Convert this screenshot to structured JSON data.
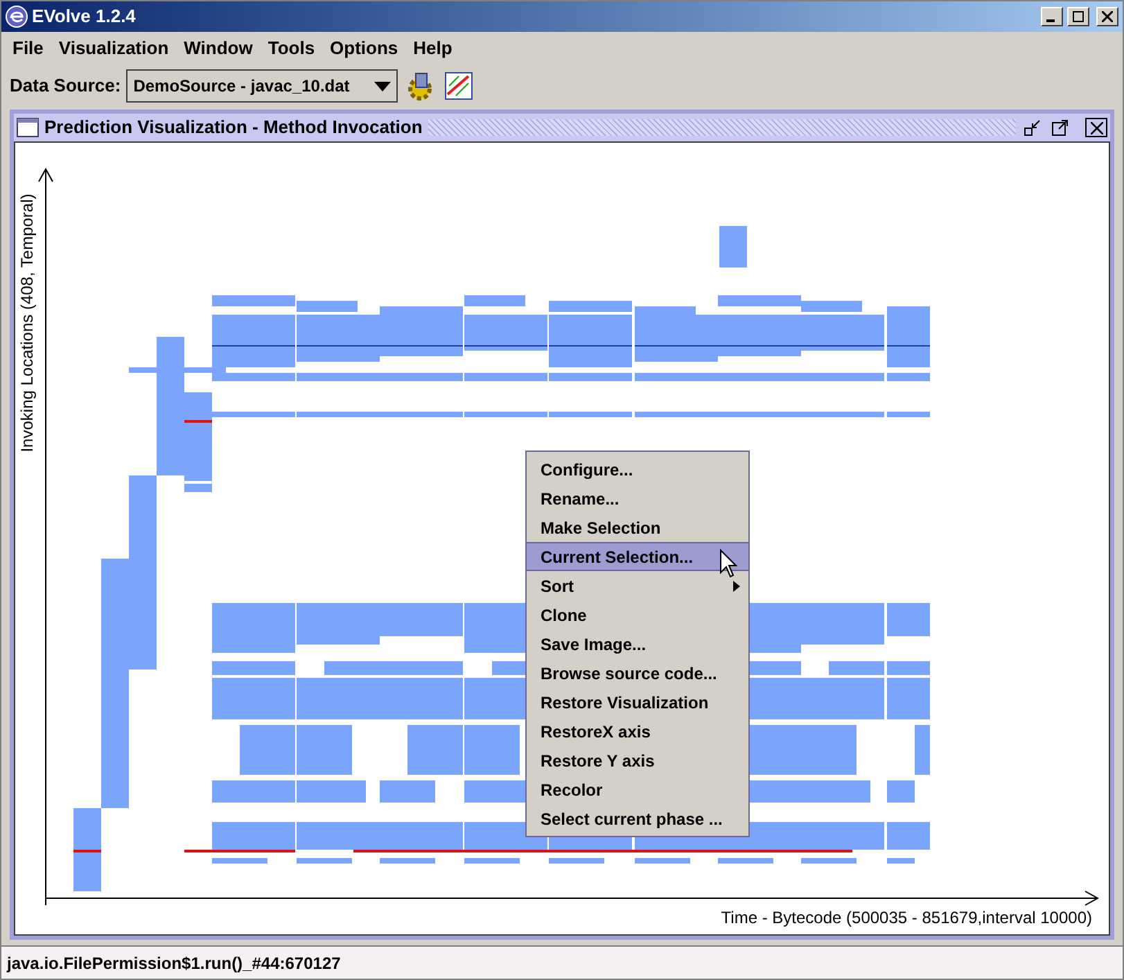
{
  "window": {
    "title": "EVolve 1.2.4"
  },
  "menu": [
    {
      "label": "File"
    },
    {
      "label": "Visualization"
    },
    {
      "label": "Window"
    },
    {
      "label": "Tools"
    },
    {
      "label": "Options"
    },
    {
      "label": "Help"
    }
  ],
  "toolbar": {
    "label": "Data Source:",
    "data_source": "DemoSource - javac_10.dat"
  },
  "frame": {
    "title": "Prediction Visualization - Method Invocation",
    "y_axis_label": "Invoking Locations (408, Temporal)",
    "x_axis_label": "Time - Bytecode (500035 - 851679,interval 10000)"
  },
  "context_menu": [
    {
      "label": "Configure...",
      "selected": false,
      "submenu": false
    },
    {
      "label": "Rename...",
      "selected": false,
      "submenu": false
    },
    {
      "label": "Make Selection",
      "selected": false,
      "submenu": false
    },
    {
      "label": "Current Selection...",
      "selected": true,
      "submenu": false
    },
    {
      "label": "Sort",
      "selected": false,
      "submenu": true
    },
    {
      "label": "Clone",
      "selected": false,
      "submenu": false
    },
    {
      "label": "Save Image...",
      "selected": false,
      "submenu": false
    },
    {
      "label": "Browse source code...",
      "selected": false,
      "submenu": false
    },
    {
      "label": "Restore Visualization",
      "selected": false,
      "submenu": false
    },
    {
      "label": "RestoreX axis",
      "selected": false,
      "submenu": false
    },
    {
      "label": "Restore Y axis",
      "selected": false,
      "submenu": false
    },
    {
      "label": "Recolor",
      "selected": false,
      "submenu": false
    },
    {
      "label": "Select current phase ...",
      "selected": false,
      "submenu": false
    }
  ],
  "status_bar": "java.io.FilePermission$1.run()_#44:670127"
}
